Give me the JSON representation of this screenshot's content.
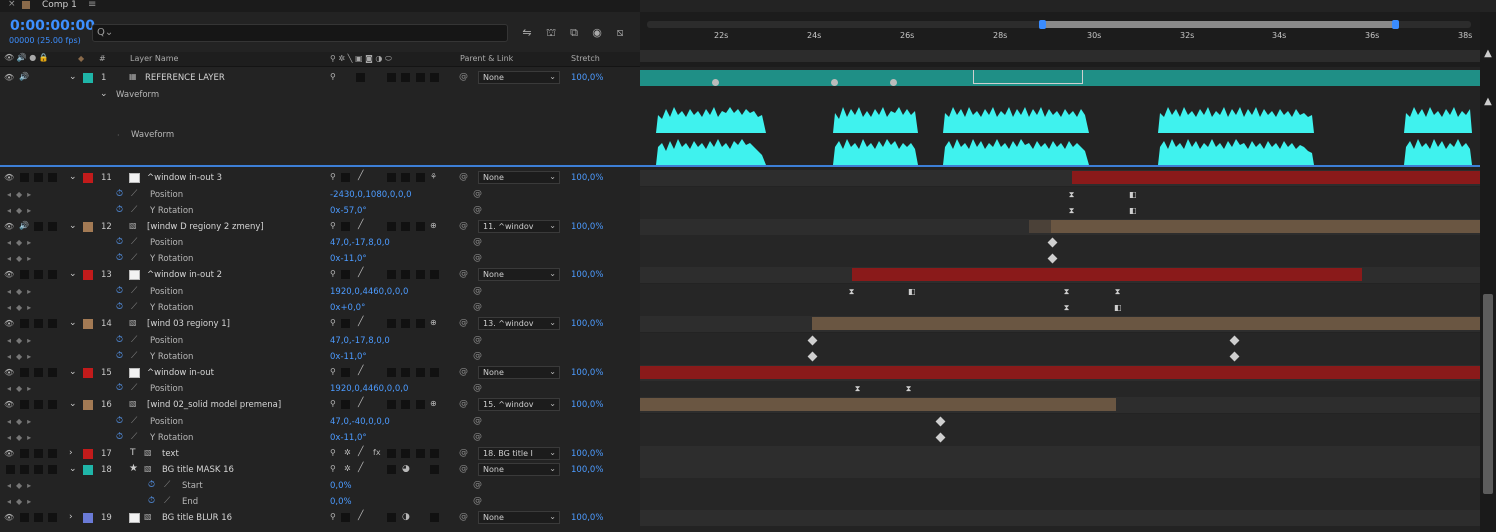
{
  "tab": {
    "close": "×",
    "title": "Comp 1",
    "menu": "≡"
  },
  "timecode": "0:00:00:00",
  "fps": "00000 (25.00 fps)",
  "search_icon": "Q⌄",
  "tools": [
    "⇋",
    "⛫",
    "⧉",
    "◉",
    "⧅"
  ],
  "columns": {
    "hash": "#",
    "layer_name": "Layer Name",
    "parent_link": "Parent & Link",
    "stretch": "Stretch",
    "switch_icons": "⚲ ✲ ╲ ▣ ◙ ◑ ⬭"
  },
  "ruler": {
    "ticks": [
      "22s",
      "24s",
      "26s",
      "28s",
      "30s",
      "32s",
      "34s",
      "36s",
      "38s"
    ]
  },
  "layers": {
    "l1": {
      "num": "1",
      "name": "REFERENCE LAYER",
      "parent": "None",
      "stretch": "100,0%",
      "waveform_group": "Waveform",
      "waveform": "Waveform"
    },
    "l11": {
      "num": "11",
      "name": "^window in-out 3",
      "parent": "None",
      "stretch": "100,0%",
      "p1": "Position",
      "v1": "-2430,0,1080,0,0,0",
      "p2": "Y Rotation",
      "v2": "0x-57,0°"
    },
    "l12": {
      "num": "12",
      "name": "[windw D regiony 2 zmeny]",
      "parent": "11. ^windov",
      "stretch": "100,0%",
      "p1": "Position",
      "v1": "47,0,-17,8,0,0",
      "p2": "Y Rotation",
      "v2": "0x-11,0°"
    },
    "l13": {
      "num": "13",
      "name": "^window in-out 2",
      "parent": "None",
      "stretch": "100,0%",
      "p1": "Position",
      "v1": "1920,0,4460,0,0,0",
      "p2": "Y Rotation",
      "v2": "0x+0,0°"
    },
    "l14": {
      "num": "14",
      "name": "[wind 03 regiony 1]",
      "parent": "13. ^windov",
      "stretch": "100,0%",
      "p1": "Position",
      "v1": "47,0,-17,8,0,0",
      "p2": "Y Rotation",
      "v2": "0x-11,0°"
    },
    "l15": {
      "num": "15",
      "name": "^window in-out",
      "parent": "None",
      "stretch": "100,0%",
      "p1": "Position",
      "v1": "1920,0,4460,0,0,0"
    },
    "l16": {
      "num": "16",
      "name": "[wind 02_solid model premena]",
      "parent": "15. ^windov",
      "stretch": "100,0%",
      "p1": "Position",
      "v1": "47,0,-40,0,0,0",
      "p2": "Y Rotation",
      "v2": "0x-11,0°"
    },
    "l17": {
      "num": "17",
      "name": "text",
      "parent": "18. BG title I",
      "stretch": "100,0%"
    },
    "l18": {
      "num": "18",
      "name": "BG title MASK 16",
      "parent": "None",
      "stretch": "100,0%",
      "p1": "Start",
      "v1": "0,0%",
      "p2": "End",
      "v2": "0,0%"
    },
    "l19": {
      "num": "19",
      "name": "BG title BLUR 16",
      "parent": "None",
      "stretch": "100,0%"
    }
  },
  "colors": {
    "teal": "#1f8f86",
    "red": "#8a1a1a",
    "tan": "#6a5642",
    "accent": "#3d8fff",
    "wave": "#3ff2ee"
  }
}
